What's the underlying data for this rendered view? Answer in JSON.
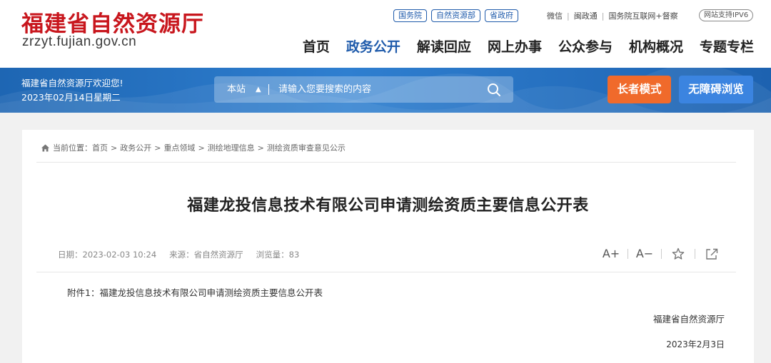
{
  "header": {
    "site_title": "福建省自然资源厅",
    "domain": "zrzyt.fujian.gov.cn",
    "top_links": [
      "国务院",
      "自然资源部",
      "省政府"
    ],
    "util_links": [
      "微信",
      "闽政通",
      "国务院互联网+督察"
    ],
    "ipv6_badge": "网站支持IPV6",
    "nav": [
      {
        "label": "首页",
        "active": false
      },
      {
        "label": "政务公开",
        "active": true
      },
      {
        "label": "解读回应",
        "active": false
      },
      {
        "label": "网上办事",
        "active": false
      },
      {
        "label": "公众参与",
        "active": false
      },
      {
        "label": "机构概况",
        "active": false
      },
      {
        "label": "专题专栏",
        "active": false
      }
    ]
  },
  "banner": {
    "welcome": "福建省自然资源厅欢迎您!",
    "date": "2023年02月14日星期二",
    "search_scope": "本站",
    "search_placeholder": "请输入您要搜索的内容",
    "elder_mode": "长者模式",
    "accessibility": "无障碍浏览"
  },
  "breadcrumb": {
    "prefix": "当前位置：",
    "items": [
      "首页",
      "政务公开",
      "重点领域",
      "测绘地理信息",
      "测绘资质审查意见公示"
    ]
  },
  "article": {
    "title": "福建龙投信息技术有限公司申请测绘资质主要信息公开表",
    "date_label": "日期：",
    "date": "2023-02-03 10:24",
    "source_label": "来源：",
    "source": "省自然资源厅",
    "views_label": "浏览量：",
    "views": "83",
    "tools": {
      "font_up": "A+",
      "font_down": "A−"
    },
    "attachment": "附件1：福建龙投信息技术有限公司申请测绘资质主要信息公开表",
    "signature": "福建省自然资源厅",
    "sign_date": "2023年2月3日"
  },
  "colors": {
    "brand_red": "#c8161d",
    "brand_blue": "#1f5bab",
    "elder_orange": "#f06a2b",
    "access_blue": "#3b84e0"
  }
}
